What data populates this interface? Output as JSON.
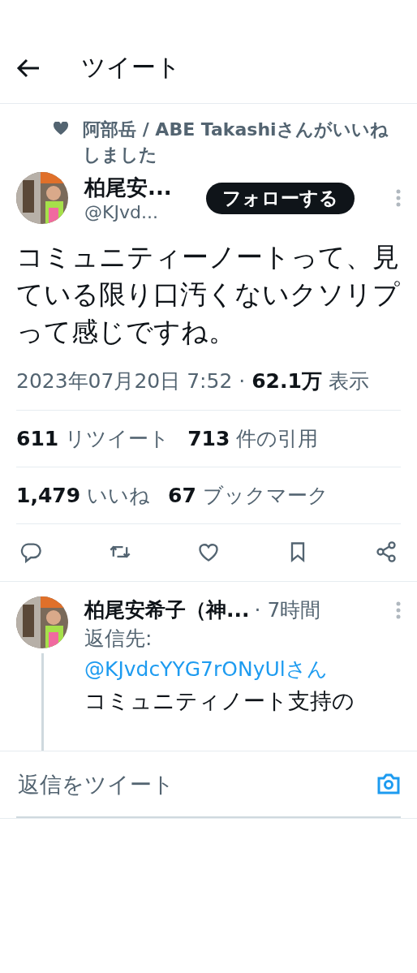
{
  "header": {
    "title": "ツイート"
  },
  "social_context": {
    "text": "阿部岳 / ABE Takashiさんがいいねしました"
  },
  "tweet": {
    "author": {
      "name": "柏尾安...",
      "handle": "@KJvd..."
    },
    "follow_button": "フォローする",
    "text": "コミュニティーノートって、見ている限り口汚くないクソリプって感じですね。",
    "meta": "2023年07月20日 7:52 · **62.1万** 表示"
  },
  "stats": [
    [
      "**611** リツイート",
      "**713** 件の引用"
    ],
    [
      "**1,479** いいね",
      "**67** ブックマーク"
    ]
  ],
  "actions": [
    {
      "kind": "reply"
    },
    {
      "kind": "retweet"
    },
    {
      "kind": "like"
    },
    {
      "kind": "bookmark"
    },
    {
      "kind": "share"
    }
  ],
  "reply": {
    "author": "柏尾安希子（神...",
    "time": "· 7時間",
    "reply_to_label": "返信先: ",
    "reply_to_handle": "@KJvdcYYG7rONyUlさん",
    "text": "コミュニティノート支持の"
  },
  "composer": {
    "placeholder": "返信をツイート"
  }
}
